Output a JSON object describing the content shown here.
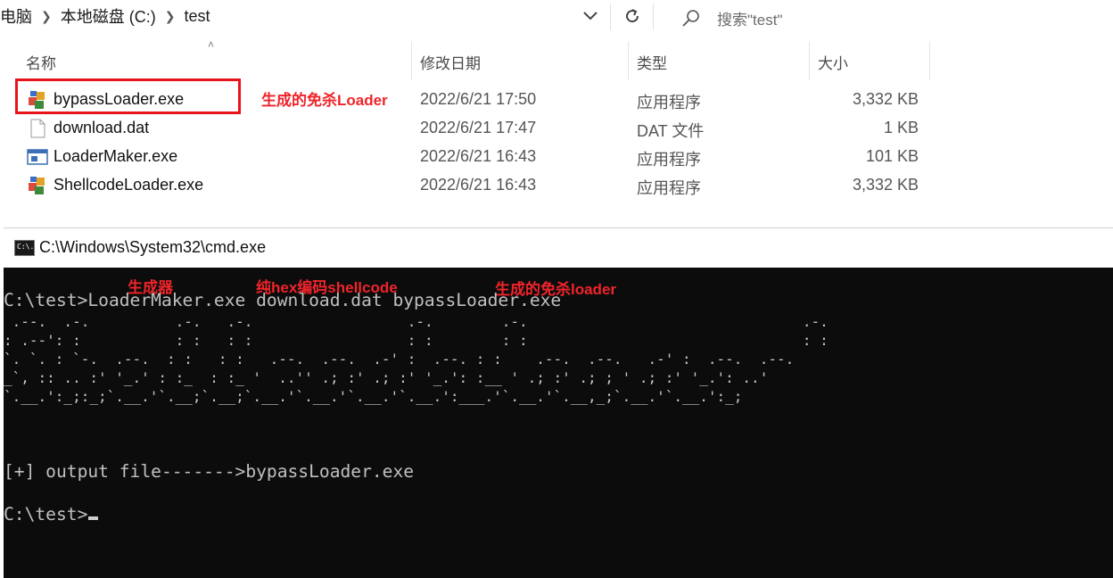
{
  "explorer": {
    "breadcrumbs": [
      "电脑",
      "本地磁盘 (C:)",
      "test"
    ],
    "search_placeholder": "搜索\"test\"",
    "columns": {
      "name": "名称",
      "date": "修改日期",
      "type": "类型",
      "size": "大小"
    },
    "files": [
      {
        "name": "bypassLoader.exe",
        "date": "2022/6/21 17:50",
        "type": "应用程序",
        "size": "3,332 KB",
        "icon": "exe-app-icon"
      },
      {
        "name": "download.dat",
        "date": "2022/6/21 17:47",
        "type": "DAT 文件",
        "size": "1 KB",
        "icon": "blank-file-icon"
      },
      {
        "name": "LoaderMaker.exe",
        "date": "2022/6/21 16:43",
        "type": "应用程序",
        "size": "101 KB",
        "icon": "window-app-icon"
      },
      {
        "name": "ShellcodeLoader.exe",
        "date": "2022/6/21 16:43",
        "type": "应用程序",
        "size": "3,332 KB",
        "icon": "exe-app-icon"
      }
    ],
    "annotation": "生成的免杀Loader",
    "annotation_color": "#f0242a"
  },
  "cmd": {
    "title": "C:\\Windows\\System32\\cmd.exe",
    "icon_text": "C:\\.",
    "command_line": "C:\\test>LoaderMaker.exe download.dat bypassLoader.exe",
    "ascii_art": [
      " .--.  .-.          .-.   .-.                  .-.        .-.                                .-.",
      ": .--': :           : :   : :                  : :        : :                                : :",
      "`. `. : `-.  .--.  : :   : :   .--.  .--.  .-' :  .--. : :    .--.  .--.   .-' :  .--.  .--.",
      "_`, :: .. :' '_.' : :_  : :_ '  ..'' .; :' .; :' '_.': :__ ' .; :' .; ; ' .; :' '_.': ..'",
      "`.__.':_;:_;`.__.'`.__;`.__;`.__.'`.__.'`.__.'`.__.':___.'`.__.'`.__,_;`.__.'`.__.':_;"
    ],
    "output_line": "[+] output file------->bypassLoader.exe",
    "prompt": "C:\\test>",
    "annotations": [
      "生成器",
      "纯hex编码shellcode",
      "生成的免杀loader"
    ]
  },
  "colors": {
    "terminal_bg": "#0c0c0c",
    "terminal_fg": "#c0c0c0",
    "annotation_red": "#f0242a"
  }
}
